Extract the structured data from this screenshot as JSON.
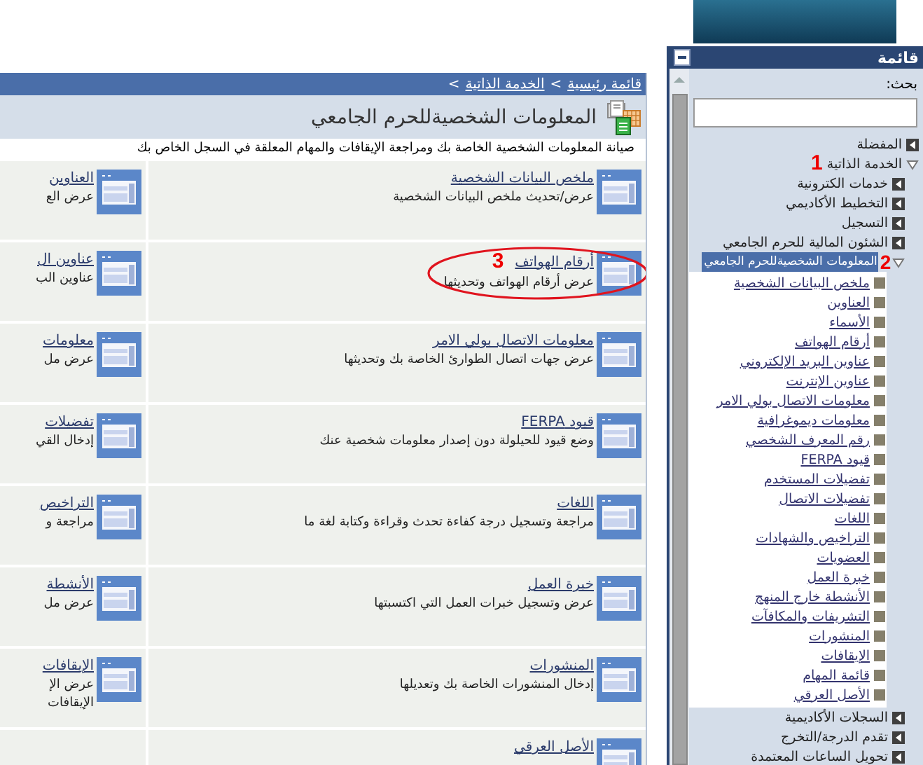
{
  "breadcrumb": [
    {
      "kind": "link",
      "label": "قائمة رئيسية"
    },
    {
      "kind": "separator",
      "label": ">"
    },
    {
      "kind": "link",
      "label": "الخدمة الذاتية"
    },
    {
      "kind": "separator",
      "label": ">"
    }
  ],
  "page": {
    "title": "المعلومات الشخصيةللحرم الجامعي",
    "description": "صيانة المعلومات الشخصية الخاصة بك ومراجعة الإيقافات والمهام المعلقة في السجل الخاص بك"
  },
  "cards": [
    {
      "cells": [
        {
          "title": "ملخص البيانات الشخصية",
          "description": [
            "عرض/تحديث ملخص البيانات الشخصية"
          ]
        },
        {
          "title": "العناوين",
          "description": [
            "عرض الع"
          ]
        }
      ]
    },
    {
      "cells": [
        {
          "title": "أرقام الهواتف",
          "description": [
            "عرض أرقام الهواتف وتحديثها"
          ],
          "marker": "3",
          "circled": true
        },
        {
          "title": "عناوين ال",
          "description": [
            "عناوين الب"
          ]
        }
      ]
    },
    {
      "cells": [
        {
          "title": "معلومات الاتصال بولي الامر",
          "description": [
            "عرض جهات اتصال الطوارئ الخاصة بك وتحديثها"
          ]
        },
        {
          "title": "معلومات",
          "description": [
            "عرض مل"
          ]
        }
      ]
    },
    {
      "cells": [
        {
          "title": "قيود FERPA",
          "description": [
            "وضع قيود للحيلولة دون إصدار معلومات شخصية عنك"
          ]
        },
        {
          "title": "تفضيلات",
          "description": [
            "إدخال القي"
          ]
        }
      ]
    },
    {
      "cells": [
        {
          "title": "اللغات",
          "description": [
            "مراجعة وتسجيل درجة كفاءة تحدث وقراءة وكتابة لغة ما"
          ]
        },
        {
          "title": "التراخيص",
          "description": [
            "مراجعة و"
          ]
        }
      ]
    },
    {
      "cells": [
        {
          "title": "خبرة العمل",
          "description": [
            "عرض وتسجيل خبرات العمل التي اكتسبتها"
          ]
        },
        {
          "title": "الأنشطة",
          "description": [
            "عرض مل"
          ]
        }
      ]
    },
    {
      "cells": [
        {
          "title": "المنشورات",
          "description": [
            "إدخال المنشورات الخاصة بك وتعديلها"
          ]
        },
        {
          "title": "الإيقافات",
          "description": [
            "عرض الإ",
            "الإيقافات"
          ]
        }
      ]
    },
    {
      "cells": [
        {
          "title": "الأصل العرقي"
        }
      ]
    }
  ],
  "sidebar": {
    "title": "قائمة",
    "search_label": "بحث:",
    "tree": [
      {
        "kind": "folder",
        "label": "المفضلة",
        "expanded": false,
        "selected": false
      },
      {
        "kind": "folder",
        "label": "الخدمة الذاتية",
        "expanded": true,
        "selected": false,
        "marker": "1",
        "children": [
          {
            "kind": "folder",
            "label": "خدمات الكترونية",
            "expanded": false,
            "selected": false
          },
          {
            "kind": "folder",
            "label": "التخطيط الأكاديمي",
            "expanded": false,
            "selected": false
          },
          {
            "kind": "folder",
            "label": "التسجيل",
            "expanded": false,
            "selected": false
          },
          {
            "kind": "folder",
            "label": "الشئون المالية للحرم الجامعي",
            "expanded": false,
            "selected": false
          },
          {
            "kind": "folder",
            "label": "المعلومات الشخصيةللحرم الجامعي",
            "expanded": true,
            "selected": true,
            "marker": "2",
            "children": [
              {
                "kind": "link",
                "label": "ملخص البيانات الشخصية"
              },
              {
                "kind": "link",
                "label": "العناوين"
              },
              {
                "kind": "link",
                "label": "الأسماء"
              },
              {
                "kind": "link",
                "label": "أرقام الهواتف"
              },
              {
                "kind": "link",
                "label": "عناوين البريد الإلكتروني"
              },
              {
                "kind": "link",
                "label": "عناوين الإنترنت"
              },
              {
                "kind": "link",
                "label": "معلومات الاتصال بولي الامر"
              },
              {
                "kind": "link",
                "label": "معلومات ديموغرافية"
              },
              {
                "kind": "link",
                "label": "رقم المعرف الشخصي"
              },
              {
                "kind": "link",
                "label": "قيود FERPA"
              },
              {
                "kind": "link",
                "label": "تفضيلات المستخدم"
              },
              {
                "kind": "link",
                "label": "تفضيلات الاتصال"
              },
              {
                "kind": "link",
                "label": "اللغات"
              },
              {
                "kind": "link",
                "label": "التراخيص والشهادات"
              },
              {
                "kind": "link",
                "label": "العضويات"
              },
              {
                "kind": "link",
                "label": "خبرة العمل"
              },
              {
                "kind": "link",
                "label": "الأنشطة خارج المنهج"
              },
              {
                "kind": "link",
                "label": "التشريفات والمكافآت"
              },
              {
                "kind": "link",
                "label": "المنشورات"
              },
              {
                "kind": "link",
                "label": "الإيقافات"
              },
              {
                "kind": "link",
                "label": "قائمة المهام"
              },
              {
                "kind": "link",
                "label": "الأصل العرقي"
              }
            ]
          },
          {
            "kind": "folder",
            "label": "السجلات الأكاديمية",
            "expanded": false,
            "selected": false
          },
          {
            "kind": "folder",
            "label": "تقدم الدرجة/التخرج",
            "expanded": false,
            "selected": false
          },
          {
            "kind": "folder",
            "label": "تحويل الساعات المعتمدة",
            "expanded": false,
            "selected": false
          }
        ]
      }
    ]
  }
}
